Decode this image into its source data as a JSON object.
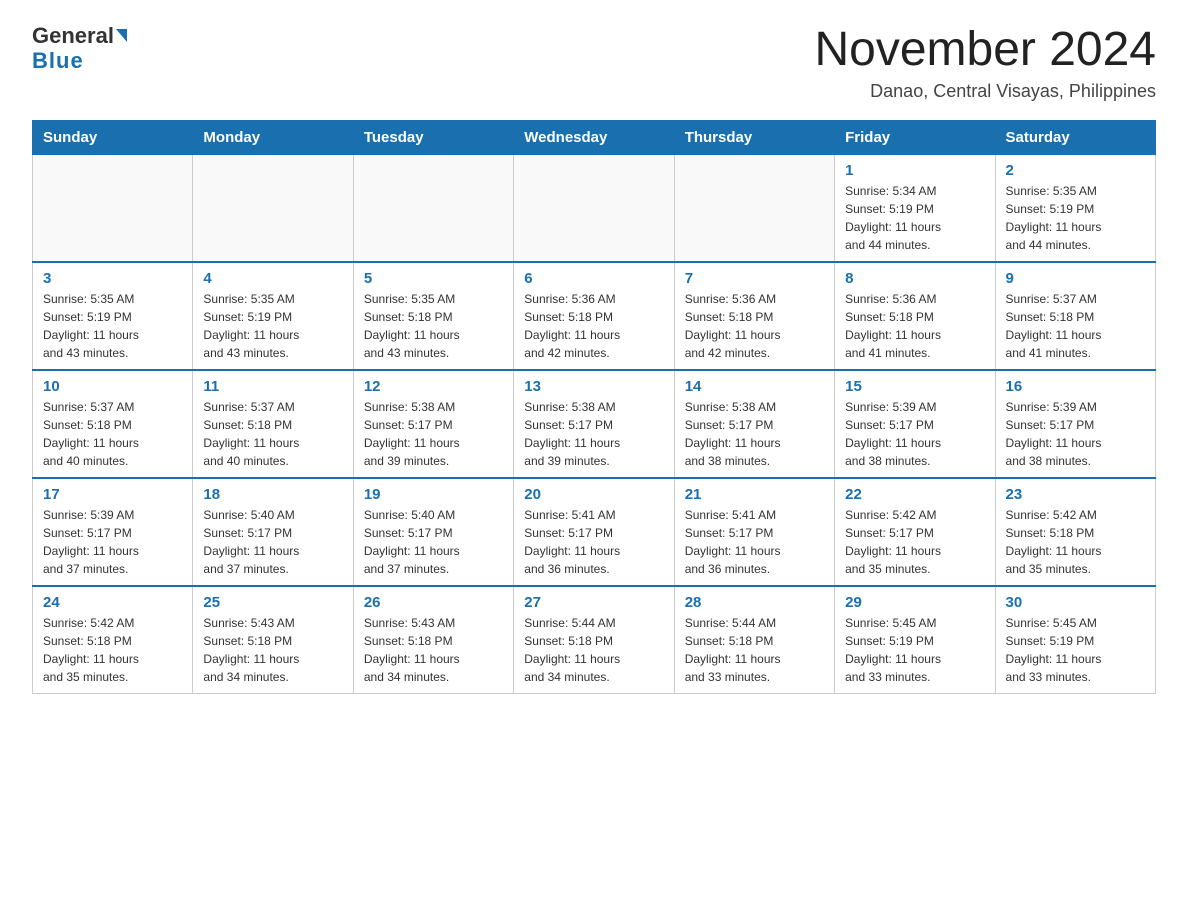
{
  "logo": {
    "general": "General",
    "triangle": "",
    "blue": "Blue"
  },
  "title": "November 2024",
  "subtitle": "Danao, Central Visayas, Philippines",
  "days_of_week": [
    "Sunday",
    "Monday",
    "Tuesday",
    "Wednesday",
    "Thursday",
    "Friday",
    "Saturday"
  ],
  "weeks": [
    [
      {
        "day": "",
        "info": ""
      },
      {
        "day": "",
        "info": ""
      },
      {
        "day": "",
        "info": ""
      },
      {
        "day": "",
        "info": ""
      },
      {
        "day": "",
        "info": ""
      },
      {
        "day": "1",
        "info": "Sunrise: 5:34 AM\nSunset: 5:19 PM\nDaylight: 11 hours\nand 44 minutes."
      },
      {
        "day": "2",
        "info": "Sunrise: 5:35 AM\nSunset: 5:19 PM\nDaylight: 11 hours\nand 44 minutes."
      }
    ],
    [
      {
        "day": "3",
        "info": "Sunrise: 5:35 AM\nSunset: 5:19 PM\nDaylight: 11 hours\nand 43 minutes."
      },
      {
        "day": "4",
        "info": "Sunrise: 5:35 AM\nSunset: 5:19 PM\nDaylight: 11 hours\nand 43 minutes."
      },
      {
        "day": "5",
        "info": "Sunrise: 5:35 AM\nSunset: 5:18 PM\nDaylight: 11 hours\nand 43 minutes."
      },
      {
        "day": "6",
        "info": "Sunrise: 5:36 AM\nSunset: 5:18 PM\nDaylight: 11 hours\nand 42 minutes."
      },
      {
        "day": "7",
        "info": "Sunrise: 5:36 AM\nSunset: 5:18 PM\nDaylight: 11 hours\nand 42 minutes."
      },
      {
        "day": "8",
        "info": "Sunrise: 5:36 AM\nSunset: 5:18 PM\nDaylight: 11 hours\nand 41 minutes."
      },
      {
        "day": "9",
        "info": "Sunrise: 5:37 AM\nSunset: 5:18 PM\nDaylight: 11 hours\nand 41 minutes."
      }
    ],
    [
      {
        "day": "10",
        "info": "Sunrise: 5:37 AM\nSunset: 5:18 PM\nDaylight: 11 hours\nand 40 minutes."
      },
      {
        "day": "11",
        "info": "Sunrise: 5:37 AM\nSunset: 5:18 PM\nDaylight: 11 hours\nand 40 minutes."
      },
      {
        "day": "12",
        "info": "Sunrise: 5:38 AM\nSunset: 5:17 PM\nDaylight: 11 hours\nand 39 minutes."
      },
      {
        "day": "13",
        "info": "Sunrise: 5:38 AM\nSunset: 5:17 PM\nDaylight: 11 hours\nand 39 minutes."
      },
      {
        "day": "14",
        "info": "Sunrise: 5:38 AM\nSunset: 5:17 PM\nDaylight: 11 hours\nand 38 minutes."
      },
      {
        "day": "15",
        "info": "Sunrise: 5:39 AM\nSunset: 5:17 PM\nDaylight: 11 hours\nand 38 minutes."
      },
      {
        "day": "16",
        "info": "Sunrise: 5:39 AM\nSunset: 5:17 PM\nDaylight: 11 hours\nand 38 minutes."
      }
    ],
    [
      {
        "day": "17",
        "info": "Sunrise: 5:39 AM\nSunset: 5:17 PM\nDaylight: 11 hours\nand 37 minutes."
      },
      {
        "day": "18",
        "info": "Sunrise: 5:40 AM\nSunset: 5:17 PM\nDaylight: 11 hours\nand 37 minutes."
      },
      {
        "day": "19",
        "info": "Sunrise: 5:40 AM\nSunset: 5:17 PM\nDaylight: 11 hours\nand 37 minutes."
      },
      {
        "day": "20",
        "info": "Sunrise: 5:41 AM\nSunset: 5:17 PM\nDaylight: 11 hours\nand 36 minutes."
      },
      {
        "day": "21",
        "info": "Sunrise: 5:41 AM\nSunset: 5:17 PM\nDaylight: 11 hours\nand 36 minutes."
      },
      {
        "day": "22",
        "info": "Sunrise: 5:42 AM\nSunset: 5:17 PM\nDaylight: 11 hours\nand 35 minutes."
      },
      {
        "day": "23",
        "info": "Sunrise: 5:42 AM\nSunset: 5:18 PM\nDaylight: 11 hours\nand 35 minutes."
      }
    ],
    [
      {
        "day": "24",
        "info": "Sunrise: 5:42 AM\nSunset: 5:18 PM\nDaylight: 11 hours\nand 35 minutes."
      },
      {
        "day": "25",
        "info": "Sunrise: 5:43 AM\nSunset: 5:18 PM\nDaylight: 11 hours\nand 34 minutes."
      },
      {
        "day": "26",
        "info": "Sunrise: 5:43 AM\nSunset: 5:18 PM\nDaylight: 11 hours\nand 34 minutes."
      },
      {
        "day": "27",
        "info": "Sunrise: 5:44 AM\nSunset: 5:18 PM\nDaylight: 11 hours\nand 34 minutes."
      },
      {
        "day": "28",
        "info": "Sunrise: 5:44 AM\nSunset: 5:18 PM\nDaylight: 11 hours\nand 33 minutes."
      },
      {
        "day": "29",
        "info": "Sunrise: 5:45 AM\nSunset: 5:19 PM\nDaylight: 11 hours\nand 33 minutes."
      },
      {
        "day": "30",
        "info": "Sunrise: 5:45 AM\nSunset: 5:19 PM\nDaylight: 11 hours\nand 33 minutes."
      }
    ]
  ]
}
